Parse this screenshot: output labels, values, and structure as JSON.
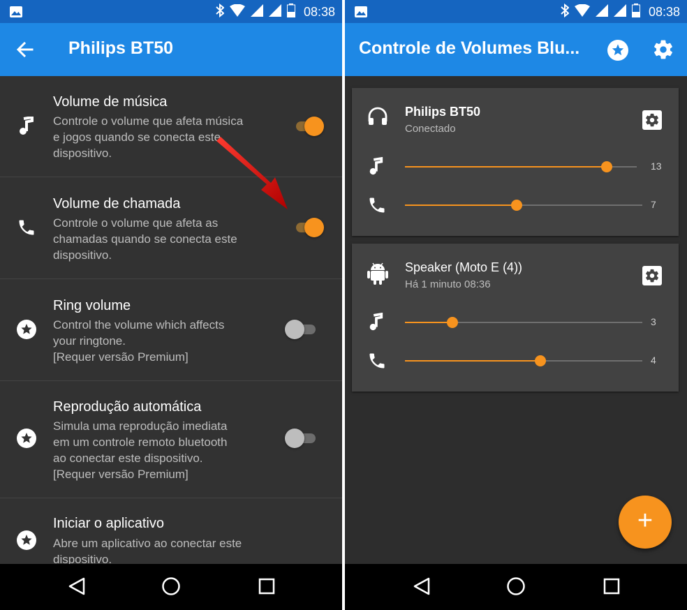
{
  "statusbar": {
    "time": "08:38"
  },
  "left": {
    "title": "Philips BT50",
    "settings": [
      {
        "title": "Volume de música",
        "desc": [
          "Controle o volume que afeta música",
          "e jogos quando se conecta este",
          "dispositivo."
        ],
        "icon": "music-note-icon",
        "enabled": true
      },
      {
        "title": "Volume de chamada",
        "desc": [
          "Controle o volume que afeta as",
          "chamadas quando se conecta este",
          "dispositivo."
        ],
        "icon": "phone-icon",
        "enabled": true
      },
      {
        "title": "Ring volume",
        "desc": [
          "Control the volume which affects",
          "your ringtone.",
          "[Requer versão Premium]"
        ],
        "icon": "star-icon",
        "enabled": false
      },
      {
        "title": "Reprodução automática",
        "desc": [
          "Simula uma reprodução imediata",
          "em um controle remoto bluetooth",
          "ao conectar este dispositivo.",
          "[Requer versão Premium]"
        ],
        "icon": "star-icon",
        "enabled": false
      },
      {
        "title": "Iniciar o aplicativo",
        "desc": [
          "Abre um aplicativo ao conectar este",
          "dispositivo."
        ],
        "icon": "star-icon"
      }
    ]
  },
  "right": {
    "title": "Controle de Volumes Blu...",
    "devices": [
      {
        "name": "Philips BT50",
        "status": "Conectado",
        "icon": "headphones-icon",
        "sliders": [
          {
            "kind": "music",
            "value": "13",
            "fraction": 0.87
          },
          {
            "kind": "call",
            "value": "7",
            "fraction": 0.47
          }
        ]
      },
      {
        "name": "Speaker (Moto E (4))",
        "status": "Há 1 minuto 08:36",
        "icon": "android-icon",
        "sliders": [
          {
            "kind": "music",
            "value": "3",
            "fraction": 0.2
          },
          {
            "kind": "call",
            "value": "4",
            "fraction": 0.57
          }
        ]
      }
    ],
    "fab_label": "+"
  },
  "colors": {
    "accent": "#f7931e",
    "appbar": "#1e88e5",
    "statusbar": "#1565c0",
    "background": "#323232",
    "card": "#424242"
  }
}
